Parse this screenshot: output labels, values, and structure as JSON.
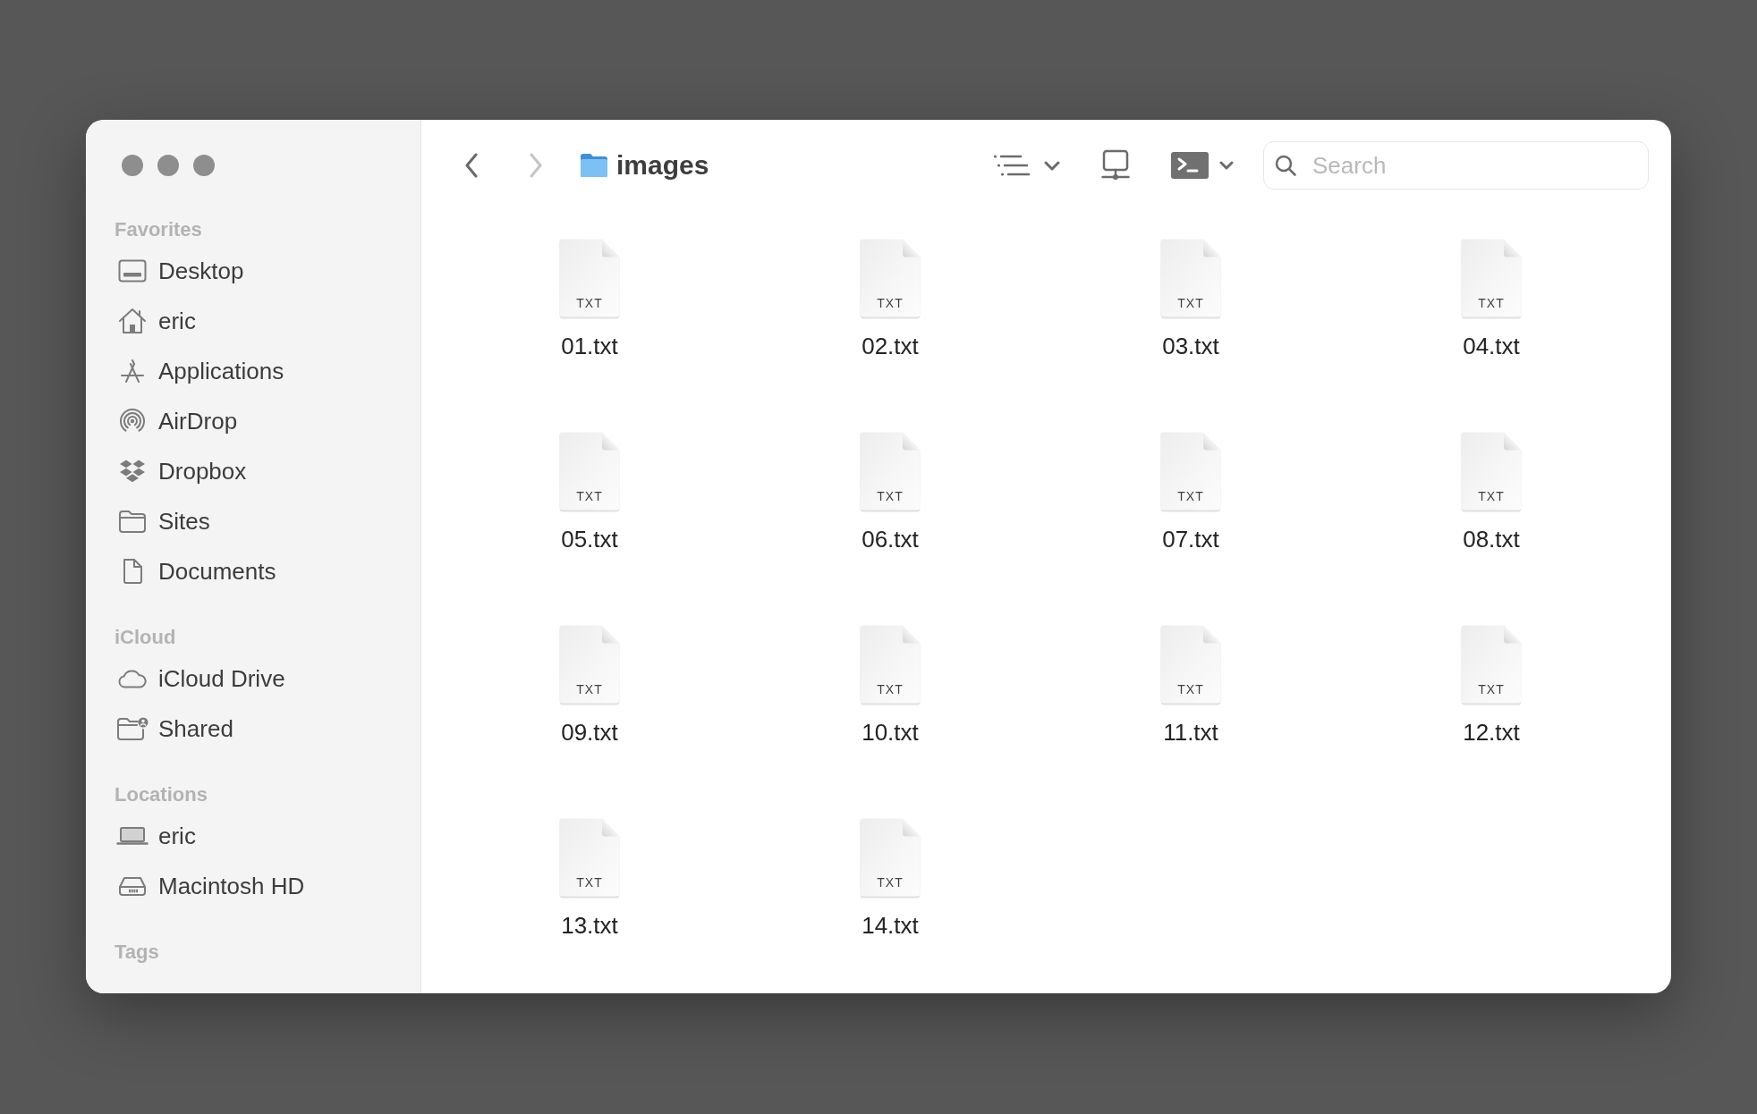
{
  "sidebar": {
    "sections": [
      {
        "title": "Favorites",
        "items": [
          {
            "label": "Desktop",
            "kind": "desktop",
            "selected": false
          },
          {
            "label": "eric",
            "kind": "home",
            "selected": false
          },
          {
            "label": "Applications",
            "kind": "apps",
            "selected": false
          },
          {
            "label": "AirDrop",
            "kind": "airdrop",
            "selected": false
          },
          {
            "label": "Dropbox",
            "kind": "dropbox",
            "selected": false
          },
          {
            "label": "Sites",
            "kind": "folder",
            "selected": false
          },
          {
            "label": "Documents",
            "kind": "document",
            "selected": false
          }
        ]
      },
      {
        "title": "iCloud",
        "items": [
          {
            "label": "iCloud Drive",
            "kind": "cloud",
            "selected": false
          },
          {
            "label": "Shared",
            "kind": "shared",
            "selected": false
          }
        ]
      },
      {
        "title": "Locations",
        "items": [
          {
            "label": "eric",
            "kind": "laptop",
            "selected": false
          },
          {
            "label": "Macintosh HD",
            "kind": "disk",
            "selected": false
          }
        ]
      },
      {
        "title": "Tags"
      }
    ]
  },
  "toolbar": {
    "back": {
      "disabled": false
    },
    "forward": {
      "disabled": true
    },
    "title": "images",
    "search": {
      "placeholder": "Search"
    }
  },
  "files": [
    {
      "name": "01.txt",
      "type": "TXT",
      "selected": false
    },
    {
      "name": "02.txt",
      "type": "TXT",
      "selected": false
    },
    {
      "name": "03.txt",
      "type": "TXT",
      "selected": false
    },
    {
      "name": "04.txt",
      "type": "TXT",
      "selected": false
    },
    {
      "name": "05.txt",
      "type": "TXT",
      "selected": false
    },
    {
      "name": "06.txt",
      "type": "TXT",
      "selected": false
    },
    {
      "name": "07.txt",
      "type": "TXT",
      "selected": false
    },
    {
      "name": "08.txt",
      "type": "TXT",
      "selected": false
    },
    {
      "name": "09.txt",
      "type": "TXT",
      "selected": false
    },
    {
      "name": "10.txt",
      "type": "TXT",
      "selected": false
    },
    {
      "name": "11.txt",
      "type": "TXT",
      "selected": false
    },
    {
      "name": "12.txt",
      "type": "TXT",
      "selected": false
    },
    {
      "name": "13.txt",
      "type": "TXT",
      "selected": false
    },
    {
      "name": "14.txt",
      "type": "TXT",
      "selected": false
    }
  ]
}
